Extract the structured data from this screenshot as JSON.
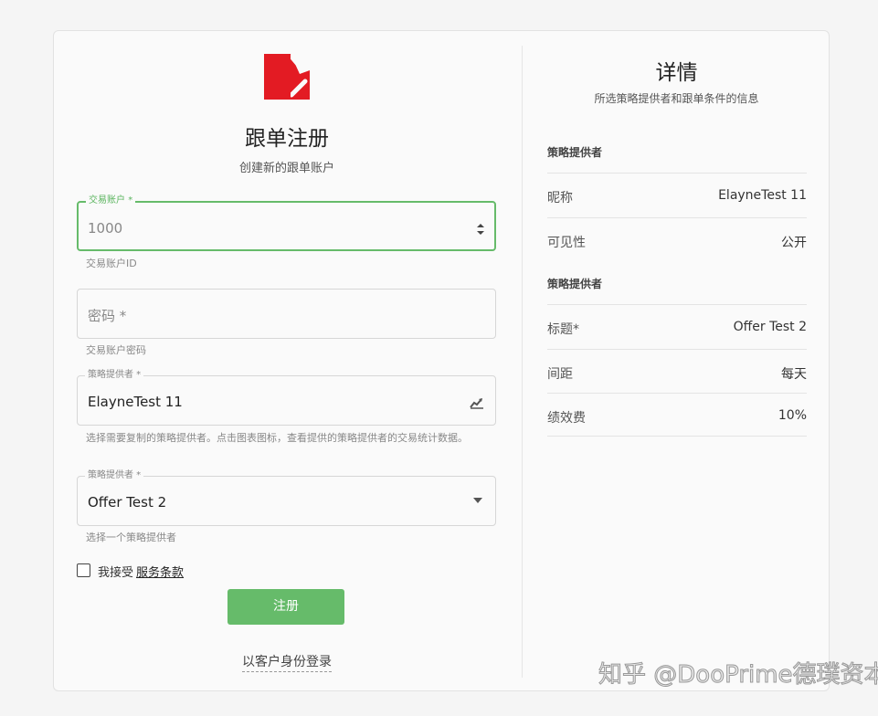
{
  "left": {
    "title": "跟单注册",
    "subtitle": "创建新的跟单账户",
    "account": {
      "label": "交易账户",
      "required_mark": "*",
      "value": "1000",
      "helper": "交易账户ID"
    },
    "password": {
      "placeholder": "密码 *",
      "helper": "交易账户密码"
    },
    "provider": {
      "label": "策略提供者 *",
      "value": "ElayneTest 11",
      "helper": "选择需要复制的策略提供者。点击图表图标，查看提供的策略提供者的交易统计数据。"
    },
    "offer": {
      "label": "策略提供者 *",
      "value": "Offer Test 2",
      "helper": "选择一个策略提供者"
    },
    "agree_text": "我接受",
    "terms_link": "服务条款",
    "submit_label": "注册",
    "client_login": "以客户身份登录"
  },
  "right": {
    "title": "详情",
    "subtitle": "所选策略提供者和跟单条件的信息",
    "section1": "策略提供者",
    "rows1": [
      {
        "key": "昵称",
        "value": "ElayneTest 11"
      },
      {
        "key": "可见性",
        "value": "公开"
      }
    ],
    "section2": "策略提供者",
    "rows2": [
      {
        "key": "标题*",
        "value": "Offer Test 2"
      },
      {
        "key": "间距",
        "value": "每天"
      },
      {
        "key": "绩效费",
        "value": "10%"
      }
    ]
  },
  "watermark": "知乎 @DooPrime德璞资本",
  "colors": {
    "accent": "#66bb6a",
    "brand_red": "#e31b23"
  },
  "icons": [
    "brand-logo",
    "number-spinner-icon",
    "chart-icon",
    "dropdown-caret-icon"
  ]
}
